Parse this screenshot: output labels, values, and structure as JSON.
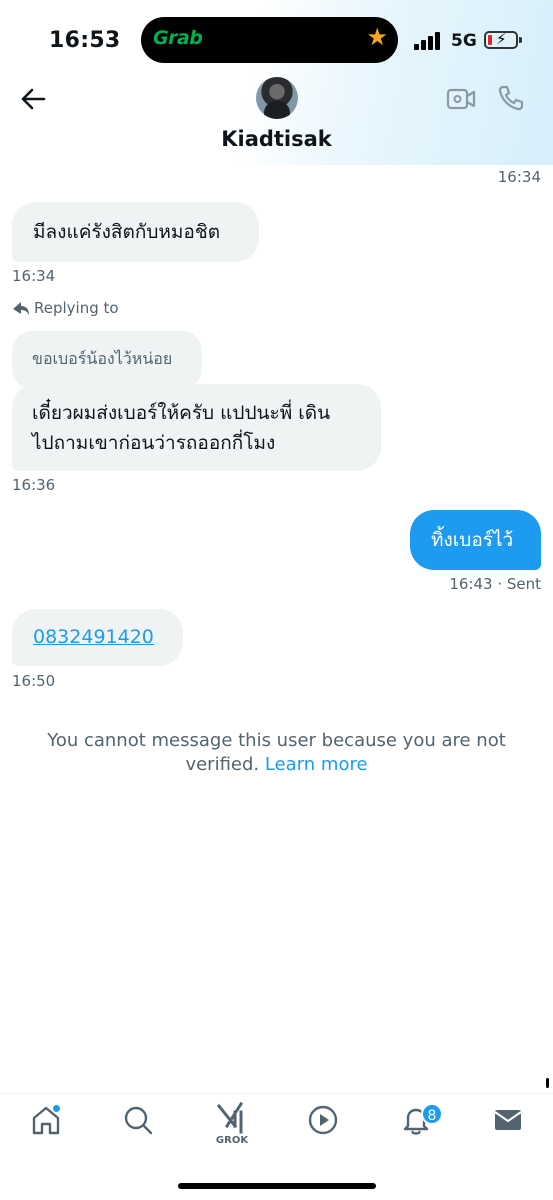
{
  "status_bar": {
    "time": "16:53",
    "island_app": "Grab",
    "island_icon": "star-icon",
    "network": "5G",
    "battery_level": 0.15,
    "battery_color": "#e0242a"
  },
  "header": {
    "contact_name": "Kiadtisak",
    "back_icon": "arrow-left-icon",
    "video_icon": "video-camera-icon",
    "call_icon": "phone-icon"
  },
  "messages": [
    {
      "type": "timestamp",
      "align": "right",
      "text": "16:34"
    },
    {
      "type": "incoming",
      "text": "มีลงแค่รังสิตกับหมอชิต",
      "time": "16:34"
    },
    {
      "type": "reply_label",
      "text": "Replying to"
    },
    {
      "type": "reply_quote",
      "text": "ขอเบอร์น้องไว้หน่อย"
    },
    {
      "type": "incoming",
      "line1": "เดี๋ยวผมส่งเบอร์ให้ครับ แปปนะพี่ เดิน",
      "line2": "ไปถามเขาก่อนว่ารถออกกี่โมง",
      "time": "16:36"
    },
    {
      "type": "outgoing",
      "text": "ทิ้งเบอร์ไว้",
      "time": "16:43 · Sent"
    },
    {
      "type": "incoming",
      "text": "0832491420",
      "is_link": true,
      "time": "16:50"
    }
  ],
  "notice": {
    "text_line1": "You cannot message this user because you are not",
    "text_line2": "verified.",
    "learn_more": "Learn more"
  },
  "bottom_nav": {
    "items": [
      "home-icon",
      "search-icon",
      "grok-icon",
      "play-icon",
      "bell-icon",
      "mail-icon"
    ],
    "grok_label": "GROK",
    "notifications_badge": "8"
  },
  "colors": {
    "accent": "#1d9bf0",
    "incoming_bubble": "#eff3f4",
    "secondary_text": "#536471"
  }
}
